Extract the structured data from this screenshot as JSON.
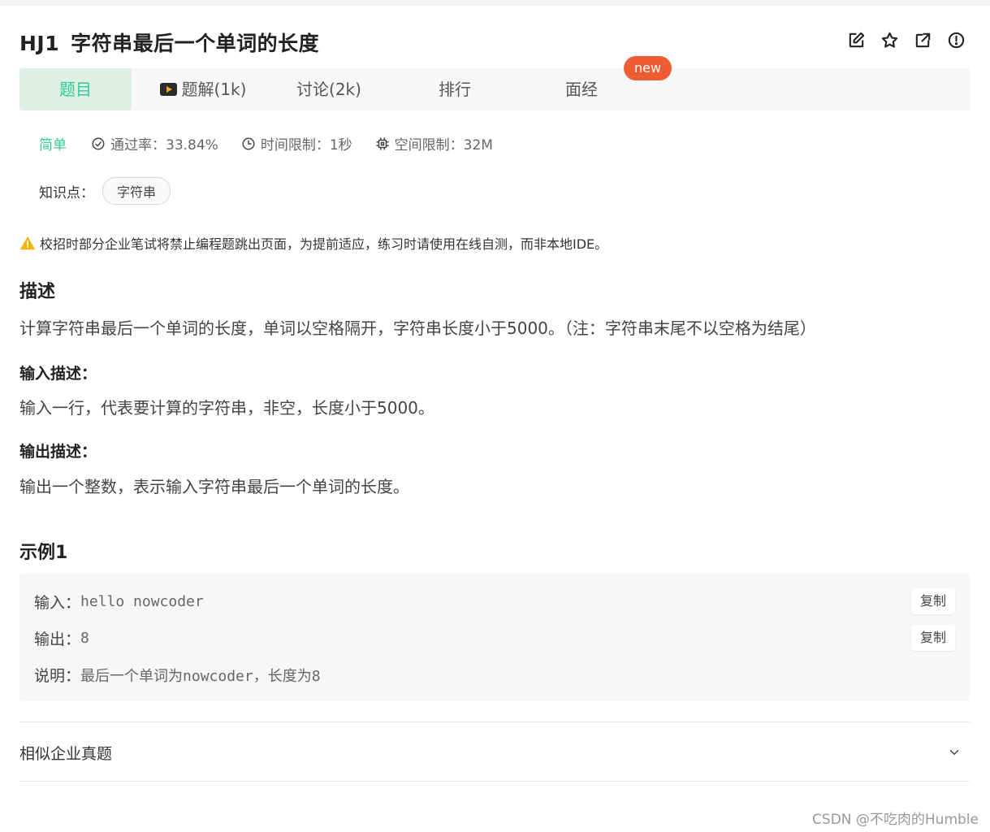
{
  "header": {
    "code": "HJ1",
    "title": "字符串最后一个单词的长度",
    "icons": [
      "edit-icon",
      "star-icon",
      "share-icon",
      "report-icon"
    ]
  },
  "tabs": [
    {
      "label": "题目",
      "active": true
    },
    {
      "label": "题解(1k)",
      "icon": "video-icon"
    },
    {
      "label": "讨论(2k)"
    },
    {
      "label": "排行"
    },
    {
      "label": "面经"
    }
  ],
  "new_badge": "new",
  "meta": {
    "difficulty": "简单",
    "pass_rate": "通过率：33.84%",
    "time_limit": "时间限制：1秒",
    "space_limit": "空间限制：32M"
  },
  "knowledge": {
    "label": "知识点：",
    "tags": [
      "字符串"
    ]
  },
  "warning": "校招时部分企业笔试将禁止编程题跳出页面，为提前适应，练习时请使用在线自测，而非本地IDE。",
  "description": {
    "heading": "描述",
    "text": "计算字符串最后一个单词的长度，单词以空格隔开，字符串长度小于5000。（注：字符串末尾不以空格为结尾）"
  },
  "input_desc": {
    "heading": "输入描述：",
    "text": "输入一行，代表要计算的字符串，非空，长度小于5000。"
  },
  "output_desc": {
    "heading": "输出描述：",
    "text": "输出一个整数，表示输入字符串最后一个单词的长度。"
  },
  "example": {
    "heading": "示例1",
    "input_label": "输入：",
    "input_value": "hello nowcoder",
    "output_label": "输出：",
    "output_value": "8",
    "explain_label": "说明：",
    "explain_value": "最后一个单词为nowcoder，长度为8",
    "copy_label": "复制"
  },
  "similar": {
    "label": "相似企业真题"
  },
  "watermark": "CSDN @不吃肉的Humble",
  "colors": {
    "accent": "#32ca99",
    "badge": "#ee5c33",
    "warning": "#f5b400"
  }
}
